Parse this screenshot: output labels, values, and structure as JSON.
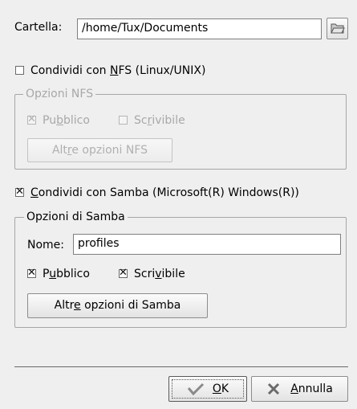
{
  "folder": {
    "label": "Cartella:",
    "value": "/home/Tux/Documents",
    "browse_icon": "folder-open-icon"
  },
  "nfs": {
    "share_label_pre": "Condividi con ",
    "share_label_mnemonic": "N",
    "share_label_post": "FS (Linux/UNIX)",
    "checked": false,
    "group_title": "Opzioni NFS",
    "public": {
      "pre": "Pu",
      "mnemonic": "b",
      "post": "blico",
      "checked": true
    },
    "writable": {
      "pre": "Sc",
      "mnemonic": "r",
      "post": "ivibile",
      "checked": false
    },
    "more_pre": "Alt",
    "more_mnemonic": "r",
    "more_post": "e opzioni NFS"
  },
  "samba": {
    "share_label_mnemonic": "C",
    "share_label_post": "ondividi con Samba (Microsoft(R) Windows(R))",
    "checked": true,
    "group_title": "Opzioni di Samba",
    "name_label": "Nome:",
    "name_value": "profiles",
    "public": {
      "pre": "P",
      "mnemonic": "u",
      "post": "bblico",
      "checked": true
    },
    "writable": {
      "pre": "Scri",
      "mnemonic": "v",
      "post": "ibile",
      "checked": true
    },
    "more_pre": "Altr",
    "more_mnemonic": "e",
    "more_post": " opzioni di Samba"
  },
  "buttons": {
    "ok_mnemonic": "O",
    "ok_post": "K",
    "ok_icon": "checkmark-icon",
    "cancel_mnemonic": "A",
    "cancel_post": "nnulla",
    "cancel_icon": "cancel-x-icon"
  }
}
